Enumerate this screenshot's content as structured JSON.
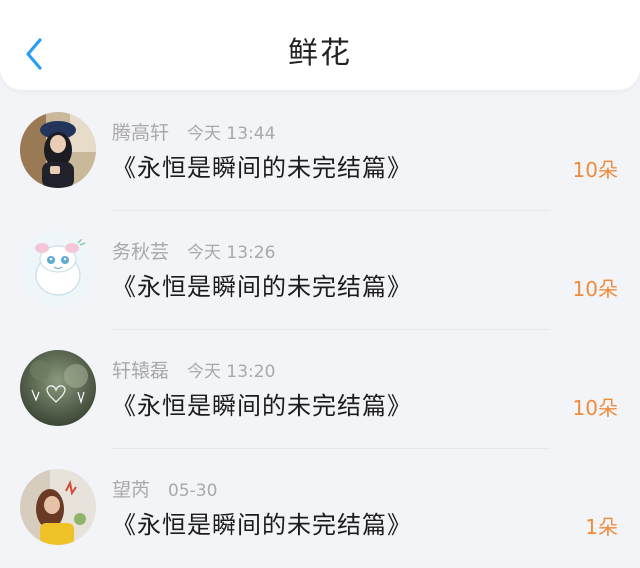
{
  "header": {
    "title": "鲜花",
    "back_icon": "chevron-left-icon",
    "back_color": "#2a9df4"
  },
  "list": {
    "items": [
      {
        "name": "腾高轩",
        "time": "今天 13:44",
        "title": "《永恒是瞬间的未完结篇》",
        "count": "10朵"
      },
      {
        "name": "务秋芸",
        "time": "今天 13:26",
        "title": "《永恒是瞬间的未完结篇》",
        "count": "10朵"
      },
      {
        "name": "轩辕磊",
        "time": "今天 13:20",
        "title": "《永恒是瞬间的未完结篇》",
        "count": "10朵"
      },
      {
        "name": "望芮",
        "time": "05-30",
        "title": "《永恒是瞬间的未完结篇》",
        "count": "1朵"
      }
    ]
  },
  "colors": {
    "accent": "#2a9df4",
    "count": "#ef8b3c",
    "meta": "#a9a9a9"
  }
}
